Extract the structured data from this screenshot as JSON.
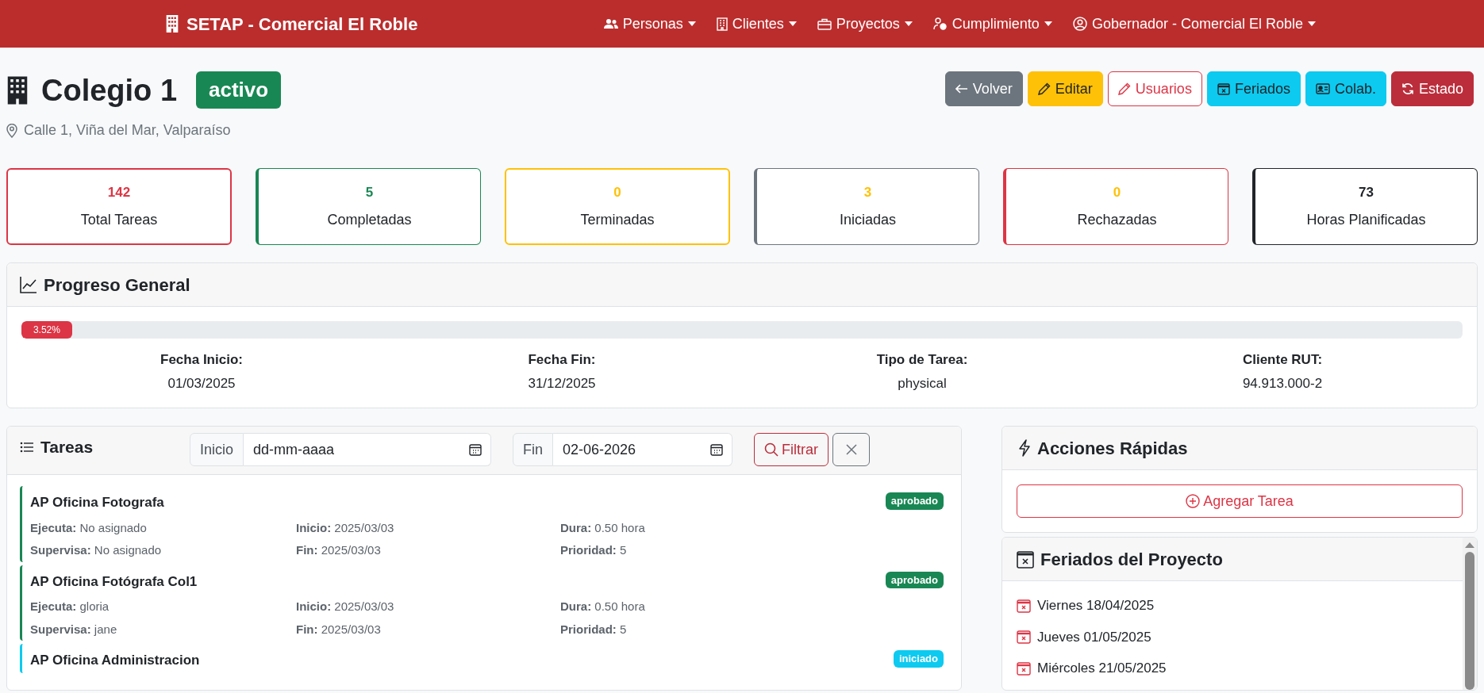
{
  "navbar": {
    "brand": "SETAP - Comercial El Roble",
    "menus": [
      {
        "label": "Personas"
      },
      {
        "label": "Clientes"
      },
      {
        "label": "Proyectos"
      },
      {
        "label": "Cumplimiento"
      },
      {
        "label": "Gobernador - Comercial El Roble"
      }
    ]
  },
  "header": {
    "title": "Colegio 1",
    "status_badge": "activo",
    "address": "Calle 1, Viña del Mar, Valparaíso",
    "buttons": [
      {
        "label": "Volver",
        "kind": "secondary"
      },
      {
        "label": "Editar",
        "kind": "warning"
      },
      {
        "label": "Usuarios",
        "kind": "outline-danger"
      },
      {
        "label": "Feriados",
        "kind": "info"
      },
      {
        "label": "Colab.",
        "kind": "info"
      },
      {
        "label": "Estado",
        "kind": "danger"
      }
    ]
  },
  "stats": [
    {
      "value": "142",
      "label": "Total Tareas",
      "color": "#dc3545",
      "kind": "full"
    },
    {
      "value": "5",
      "label": "Completadas",
      "color": "#198754",
      "kind": "left"
    },
    {
      "value": "0",
      "label": "Terminadas",
      "color": "#ffc107",
      "kind": "full"
    },
    {
      "value": "3",
      "label": "Iniciadas",
      "color": "#6c757d",
      "kind": "left"
    },
    {
      "value": "0",
      "label": "Rechazadas",
      "color": "#dc3545",
      "kind": "left"
    },
    {
      "value": "73",
      "label": "Horas Planificadas",
      "color": "#212529",
      "kind": "left"
    }
  ],
  "progress": {
    "title": "Progreso General",
    "level": 0.0352,
    "reading": "3.52%",
    "facts": [
      {
        "label": "Fecha Inicio:",
        "value": "01/03/2025"
      },
      {
        "label": "Fecha Fin:",
        "value": "31/12/2025"
      },
      {
        "label": "Tipo de Tarea:",
        "value": "physical"
      },
      {
        "label": "Cliente RUT:",
        "value": "94.913.000-2"
      }
    ]
  },
  "tasks": {
    "title": "Tareas",
    "filter": {
      "start_label": "Inicio",
      "start_placeholder": "dd-mm-aaaa",
      "end_label": "Fin",
      "end_value": "02-06-2026",
      "filter_button": "Filtrar"
    },
    "items": [
      {
        "name": "AP Oficina Fotografa",
        "status": "aprobado",
        "color": "#198754",
        "fields": [
          {
            "label": "Ejecuta:",
            "value": "No asignado"
          },
          {
            "label": "Inicio:",
            "value": "2025/03/03"
          },
          {
            "label": "Dura:",
            "value": "0.50 hora"
          },
          {
            "label": "Supervisa:",
            "value": "No asignado"
          },
          {
            "label": "Fin:",
            "value": "2025/03/03"
          },
          {
            "label": "Prioridad:",
            "value": "5"
          }
        ]
      },
      {
        "name": "AP Oficina Fotógrafa Col1",
        "status": "aprobado",
        "color": "#198754",
        "fields": [
          {
            "label": "Ejecuta:",
            "value": "gloria"
          },
          {
            "label": "Inicio:",
            "value": "2025/03/03"
          },
          {
            "label": "Dura:",
            "value": "0.50 hora"
          },
          {
            "label": "Supervisa:",
            "value": "jane"
          },
          {
            "label": "Fin:",
            "value": "2025/03/03"
          },
          {
            "label": "Prioridad:",
            "value": "5"
          }
        ]
      },
      {
        "name": "AP Oficina Administracion",
        "status": "iniciado",
        "color": "#0dcaf0"
      }
    ]
  },
  "quick_actions": {
    "title": "Acciones Rápidas",
    "button": "Agregar Tarea"
  },
  "holidays": {
    "title": "Feriados del Proyecto",
    "items": [
      "Viernes 18/04/2025",
      "Jueves 01/05/2025",
      "Miércoles 21/05/2025"
    ]
  }
}
